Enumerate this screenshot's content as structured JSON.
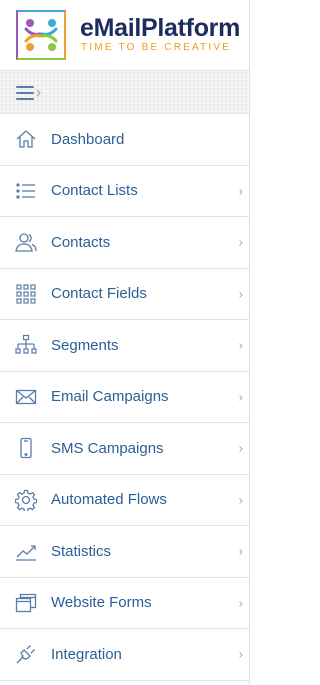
{
  "brand": {
    "name": "eMailPlatform",
    "tagline": "TIME TO BE CREATIVE",
    "colors": {
      "name": "#1d2c5e",
      "tagline": "#f39c12"
    }
  },
  "sidebar": {
    "toggle_icon": "menu-collapse-icon",
    "items": [
      {
        "label": "Dashboard",
        "icon": "home-icon",
        "has_submenu": false
      },
      {
        "label": "Contact Lists",
        "icon": "list-icon",
        "has_submenu": true
      },
      {
        "label": "Contacts",
        "icon": "users-icon",
        "has_submenu": true
      },
      {
        "label": "Contact Fields",
        "icon": "grid-icon",
        "has_submenu": true
      },
      {
        "label": "Segments",
        "icon": "sitemap-icon",
        "has_submenu": true
      },
      {
        "label": "Email Campaigns",
        "icon": "envelope-icon",
        "has_submenu": true
      },
      {
        "label": "SMS Campaigns",
        "icon": "mobile-icon",
        "has_submenu": true
      },
      {
        "label": "Automated Flows",
        "icon": "gear-icon",
        "has_submenu": true
      },
      {
        "label": "Statistics",
        "icon": "chart-icon",
        "has_submenu": true
      },
      {
        "label": "Website Forms",
        "icon": "windows-icon",
        "has_submenu": true
      },
      {
        "label": "Integration",
        "icon": "plug-icon",
        "has_submenu": true
      }
    ],
    "colors": {
      "label": "#2b5f96",
      "icon": "#5a7ea8",
      "chevron": "#a8a8a8"
    }
  }
}
